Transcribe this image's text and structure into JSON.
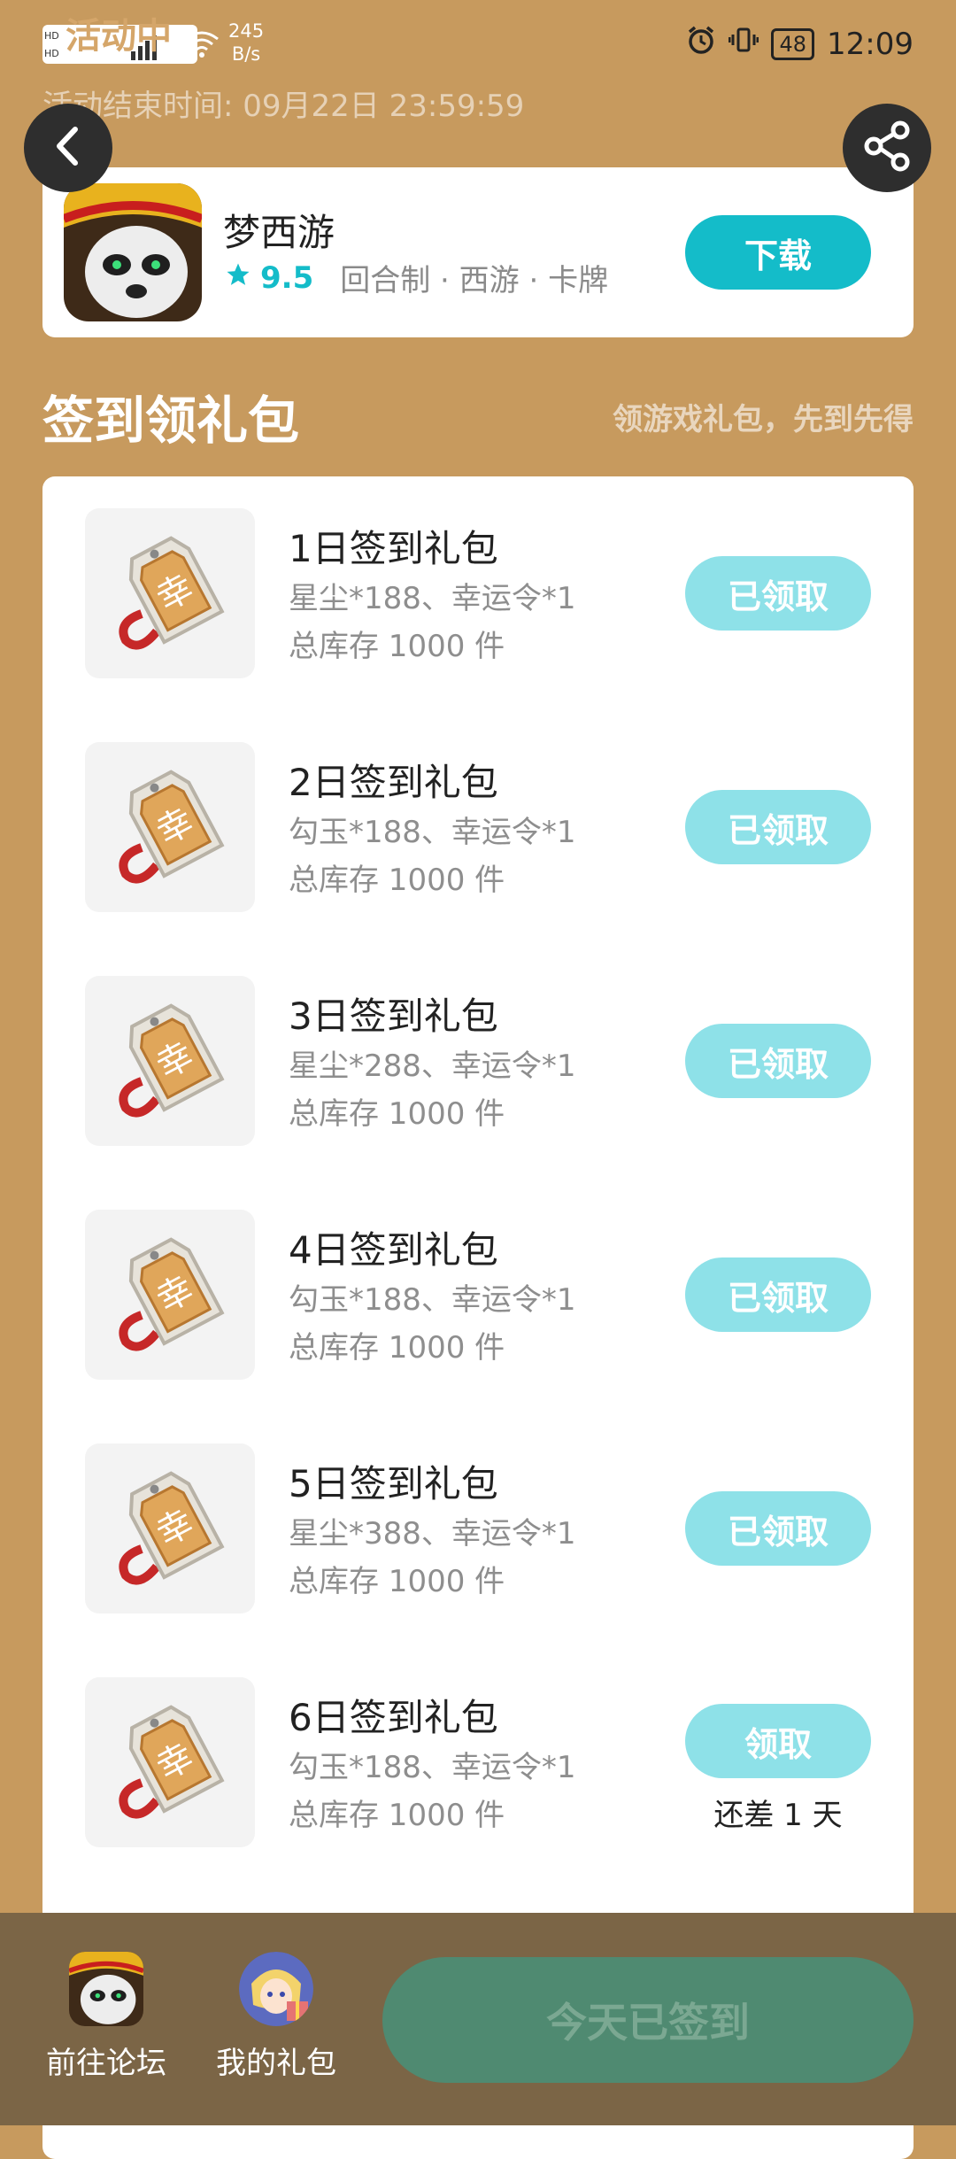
{
  "status_bar": {
    "activity_tag": "活动中",
    "speed_value": "245",
    "speed_unit": "B/s",
    "battery": "48",
    "time": "12:09"
  },
  "header": {
    "end_time": "活动结束时间: 09月22日 23:59:59"
  },
  "app": {
    "name": "梦西游",
    "rating": "9.5",
    "tags": "回合制 · 西游 · 卡牌",
    "download_label": "下载"
  },
  "section": {
    "title": "签到领礼包",
    "subtitle": "领游戏礼包，先到先得"
  },
  "gifts": [
    {
      "title": "1日签到礼包",
      "desc": "星尘*188、幸运令*1",
      "stock": "总库存 1000 件",
      "button": "已领取",
      "note": ""
    },
    {
      "title": "2日签到礼包",
      "desc": "勾玉*188、幸运令*1",
      "stock": "总库存 1000 件",
      "button": "已领取",
      "note": ""
    },
    {
      "title": "3日签到礼包",
      "desc": "星尘*288、幸运令*1",
      "stock": "总库存 1000 件",
      "button": "已领取",
      "note": ""
    },
    {
      "title": "4日签到礼包",
      "desc": "勾玉*188、幸运令*1",
      "stock": "总库存 1000 件",
      "button": "已领取",
      "note": ""
    },
    {
      "title": "5日签到礼包",
      "desc": "星尘*388、幸运令*1",
      "stock": "总库存 1000 件",
      "button": "已领取",
      "note": ""
    },
    {
      "title": "6日签到礼包",
      "desc": "勾玉*188、幸运令*1",
      "stock": "总库存 1000 件",
      "button": "领取",
      "note": "还差 1 天"
    }
  ],
  "bottom_bar": {
    "forum_label": "前往论坛",
    "gifts_label": "我的礼包",
    "signed_label": "今天已签到"
  },
  "colors": {
    "background": "#C79A5E",
    "accent": "#14BCC9",
    "claimed_button": "#8EE1E8",
    "bottom_bar": "#7B6546",
    "signed_button": "#4F8A71"
  }
}
